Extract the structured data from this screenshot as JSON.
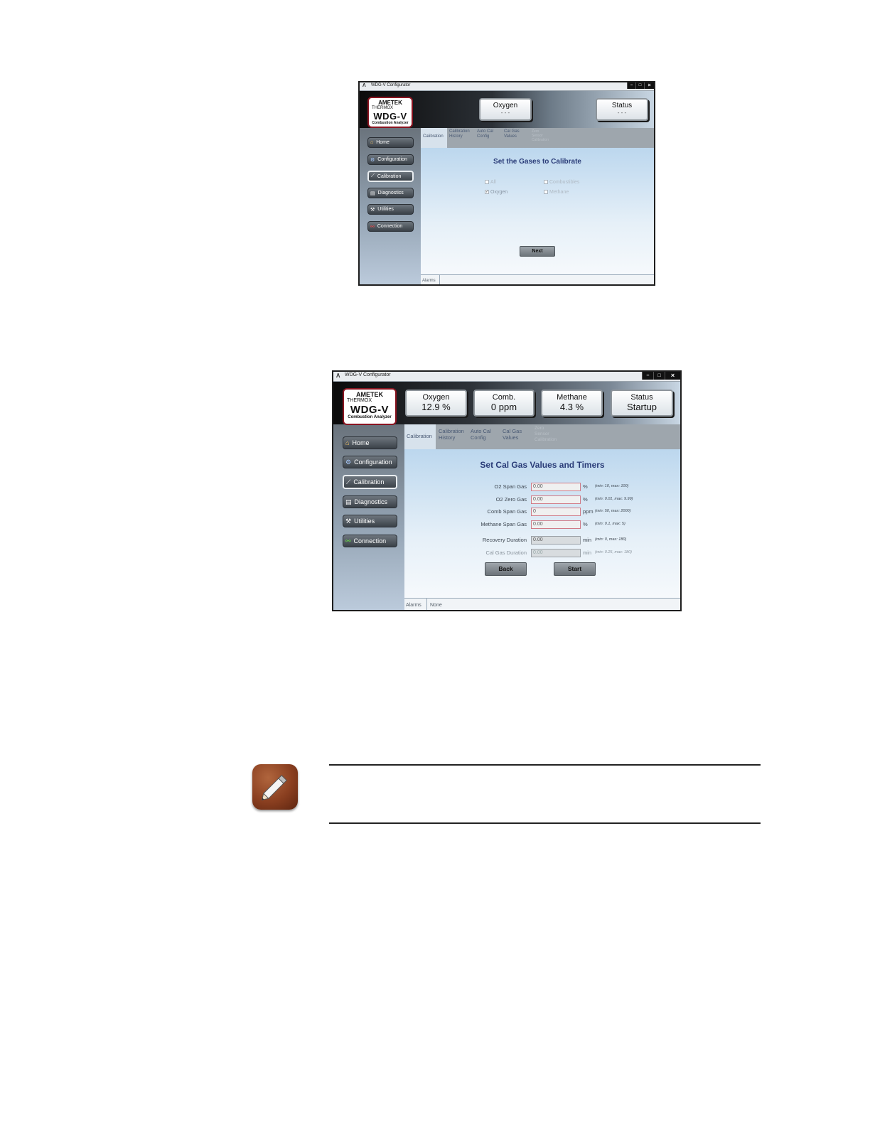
{
  "screen1": {
    "window_title": "WDG-V Configurator",
    "logo": {
      "brand": "AMETEK",
      "sub": "THERMOX",
      "model": "WDG-V",
      "caption": "Combustion Analyzer"
    },
    "indicators": [
      {
        "label": "Oxygen",
        "value": "- - -"
      },
      {
        "label": "Status",
        "value": "- - -"
      }
    ],
    "nav": [
      "Home",
      "Configuration",
      "Calibration",
      "Diagnostics",
      "Utilities",
      "Connection"
    ],
    "tabs": [
      {
        "line1": "Calibration",
        "line2": ""
      },
      {
        "line1": "Calibration",
        "line2": "History"
      },
      {
        "line1": "Auto Cal",
        "line2": "Config"
      },
      {
        "line1": "Cal Gas",
        "line2": "Values"
      },
      {
        "line1": "Zero",
        "line2": "Sensor",
        "line3": "Calibration"
      }
    ],
    "title": "Set the Gases to Calibrate",
    "options": {
      "all": "All",
      "oxygen": "Oxygen",
      "combustibles": "Combustibles",
      "methane": "Methane"
    },
    "next_label": "Next",
    "alarms_label": "Alarms"
  },
  "screen2": {
    "window_title": "WDG-V Configurator",
    "logo": {
      "brand": "AMETEK",
      "sub": "THERMOX",
      "model": "WDG-V",
      "caption": "Combustion Analyzer"
    },
    "indicators": [
      {
        "label": "Oxygen",
        "value": "12.9 %"
      },
      {
        "label": "Comb.",
        "value": "0 ppm"
      },
      {
        "label": "Methane",
        "value": "4.3 %"
      },
      {
        "label": "Status",
        "value": "Startup"
      }
    ],
    "nav": [
      "Home",
      "Configuration",
      "Calibration",
      "Diagnostics",
      "Utilities",
      "Connection"
    ],
    "tabs": [
      {
        "line1": "Calibration",
        "line2": ""
      },
      {
        "line1": "Calibration",
        "line2": "History"
      },
      {
        "line1": "Auto Cal",
        "line2": "Config"
      },
      {
        "line1": "Cal Gas",
        "line2": "Values"
      },
      {
        "line1": "Zero",
        "line2": "Sensor",
        "line3": "Calibration"
      }
    ],
    "title": "Set Cal Gas Values and Timers",
    "fields": [
      {
        "label": "O2 Span Gas",
        "value": "0.00",
        "unit": "%",
        "range": "(min: 10, max: 100)"
      },
      {
        "label": "O2 Zero Gas",
        "value": "0.00",
        "unit": "%",
        "range": "(min: 0.01, max: 9.99)"
      },
      {
        "label": "Comb Span Gas",
        "value": "0",
        "unit": "ppm",
        "range": "(min: 50, max: 2000)"
      },
      {
        "label": "Methane Span Gas",
        "value": "0.00",
        "unit": "%",
        "range": "(min: 0.1, max: 5)"
      },
      {
        "label": "Recovery Duration",
        "value": "0.00",
        "unit": "min",
        "range": "(min: 0, max: 180)"
      },
      {
        "label": "Cal Gas Duration",
        "value": "0.00",
        "unit": "min",
        "range": "(min: 0.25, max: 180)"
      }
    ],
    "back_label": "Back",
    "start_label": "Start",
    "alarms_label": "Alarms",
    "alarms_value": "None"
  }
}
